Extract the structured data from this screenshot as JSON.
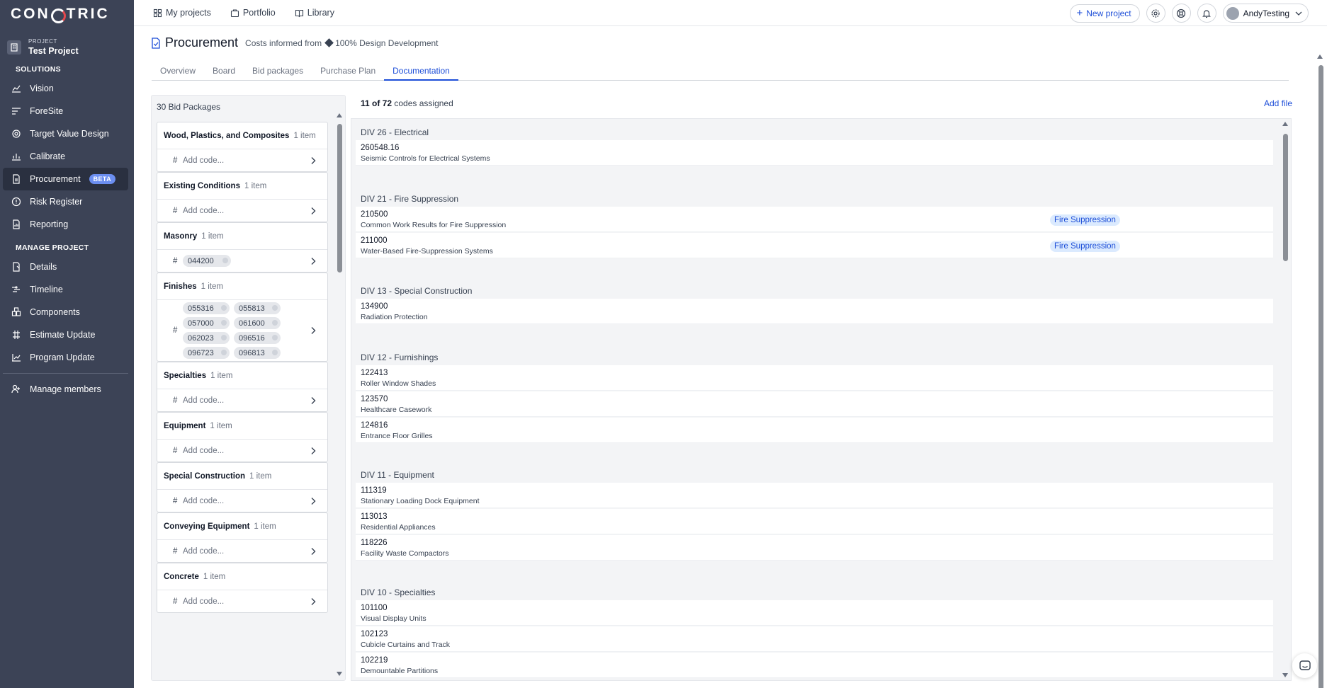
{
  "app": {
    "logo_text_left": "CON",
    "logo_text_right": "TRIC"
  },
  "project": {
    "label": "PROJECT",
    "name": "Test Project"
  },
  "sidebar": {
    "solutions_heading": "SOLUTIONS",
    "solutions": [
      {
        "label": "Vision",
        "icon": "chart-line-icon"
      },
      {
        "label": "ForeSite",
        "icon": "foresite-icon"
      },
      {
        "label": "Target Value Design",
        "icon": "target-icon"
      },
      {
        "label": "Calibrate",
        "icon": "calibrate-icon"
      },
      {
        "label": "Procurement",
        "icon": "document-icon",
        "badge": "BETA",
        "active": true
      },
      {
        "label": "Risk Register",
        "icon": "risk-icon"
      },
      {
        "label": "Reporting",
        "icon": "report-icon"
      }
    ],
    "manage_heading": "MANAGE PROJECT",
    "manage": [
      {
        "label": "Details",
        "icon": "details-icon"
      },
      {
        "label": "Timeline",
        "icon": "timeline-icon"
      },
      {
        "label": "Components",
        "icon": "components-icon"
      },
      {
        "label": "Estimate Update",
        "icon": "estimate-icon"
      },
      {
        "label": "Program Update",
        "icon": "program-icon"
      }
    ],
    "members_label": "Manage members"
  },
  "topbar": {
    "links": [
      "My projects",
      "Portfolio",
      "Library"
    ],
    "new_project": "New project",
    "user": "AndyTesting"
  },
  "page": {
    "title": "Procurement",
    "costs_prefix": "Costs informed from",
    "costs_source": "100% Design Development",
    "tabs": [
      "Overview",
      "Board",
      "Bid packages",
      "Purchase Plan",
      "Documentation"
    ],
    "active_tab": "Documentation"
  },
  "left_panel": {
    "heading": "30 Bid Packages",
    "add_code_placeholder": "Add code...",
    "packages": [
      {
        "name": "Wood, Plastics, and Composites",
        "count": "1 item",
        "codes": []
      },
      {
        "name": "Existing Conditions",
        "count": "1 item",
        "codes": []
      },
      {
        "name": "Masonry",
        "count": "1 item",
        "codes": [
          "044200"
        ]
      },
      {
        "name": "Finishes",
        "count": "1 item",
        "codes": [
          "055316",
          "055813",
          "057000",
          "061600",
          "062023",
          "096516",
          "096723",
          "096813"
        ]
      },
      {
        "name": "Specialties",
        "count": "1 item",
        "codes": []
      },
      {
        "name": "Equipment",
        "count": "1 item",
        "codes": []
      },
      {
        "name": "Special Construction",
        "count": "1 item",
        "codes": []
      },
      {
        "name": "Conveying Equipment",
        "count": "1 item",
        "codes": []
      },
      {
        "name": "Concrete",
        "count": "1 item",
        "codes": []
      }
    ]
  },
  "right_panel": {
    "assigned": "11 of 72",
    "assigned_suffix": "codes assigned",
    "add_file": "Add file",
    "divisions": [
      {
        "name": "DIV 26 - Electrical",
        "codes": [
          {
            "code": "260548.16",
            "desc": "Seismic Controls for Electrical Systems",
            "tag": ""
          }
        ]
      },
      {
        "name": "DIV 21 - Fire Suppression",
        "codes": [
          {
            "code": "210500",
            "desc": "Common Work Results for Fire Suppression",
            "tag": "Fire Suppression"
          },
          {
            "code": "211000",
            "desc": "Water-Based Fire-Suppression Systems",
            "tag": "Fire Suppression"
          }
        ]
      },
      {
        "name": "DIV 13 - Special Construction",
        "codes": [
          {
            "code": "134900",
            "desc": "Radiation Protection",
            "tag": ""
          }
        ]
      },
      {
        "name": "DIV 12 - Furnishings",
        "codes": [
          {
            "code": "122413",
            "desc": "Roller Window Shades",
            "tag": ""
          },
          {
            "code": "123570",
            "desc": "Healthcare Casework",
            "tag": ""
          },
          {
            "code": "124816",
            "desc": "Entrance Floor Grilles",
            "tag": ""
          }
        ]
      },
      {
        "name": "DIV 11 - Equipment",
        "codes": [
          {
            "code": "111319",
            "desc": "Stationary Loading Dock Equipment",
            "tag": ""
          },
          {
            "code": "113013",
            "desc": "Residential Appliances",
            "tag": ""
          },
          {
            "code": "118226",
            "desc": "Facility Waste Compactors",
            "tag": ""
          }
        ]
      },
      {
        "name": "DIV 10 - Specialties",
        "codes": [
          {
            "code": "101100",
            "desc": "Visual Display Units",
            "tag": ""
          },
          {
            "code": "102123",
            "desc": "Cubicle Curtains and Track",
            "tag": ""
          },
          {
            "code": "102219",
            "desc": "Demountable Partitions",
            "tag": ""
          }
        ]
      }
    ]
  },
  "colors": {
    "sidebar_bg": "#3c4356",
    "accent": "#1d4ed8",
    "tag_bg": "#dbeafe",
    "beta_bg": "#6b8ef0"
  }
}
